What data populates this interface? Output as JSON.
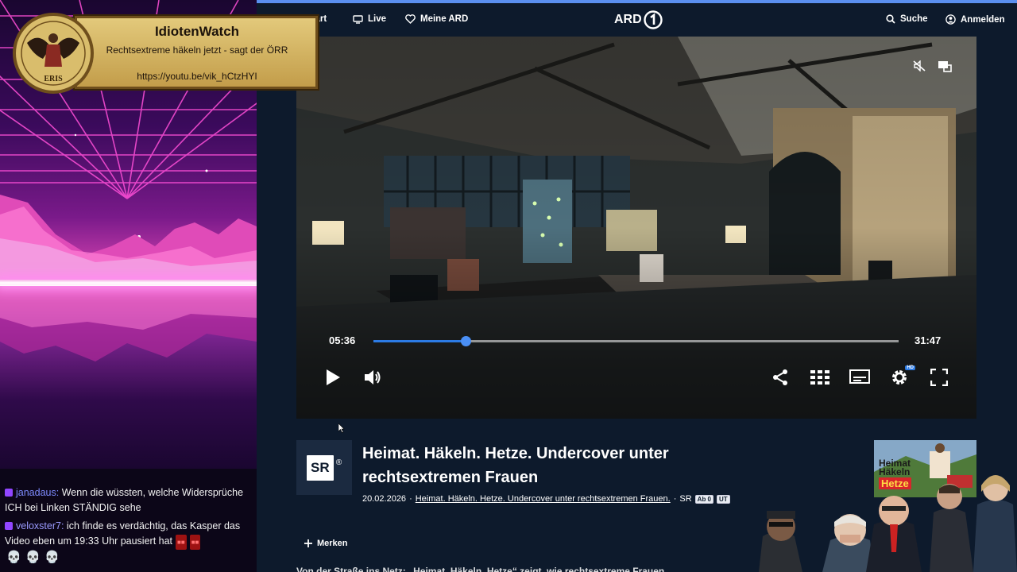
{
  "overlay": {
    "badge": {
      "title": "IdiotenWatch",
      "subtitle": "Rechtsextreme häkeln jetzt - sagt der ÖRR",
      "url": "https://youtu.be/vik_hCtzHYI",
      "seal_text": "ERIS"
    },
    "chat": [
      {
        "user": "janadaus:",
        "text": " Wenn die wüssten, welche Widersprüche ICH bei Linken STÄNDIG sehe",
        "emotes": []
      },
      {
        "user": "veloxster7:",
        "text": " ich finde es verdächtig, das Kasper das Video eben um 19:33 Uhr pausiert hat",
        "emotes": [
          "💀",
          "💀",
          "💀"
        ]
      }
    ]
  },
  "ard": {
    "nav": {
      "start": "Start",
      "live": "Live",
      "meine_ard": "Meine ARD",
      "logo": "ARD",
      "search": "Suche",
      "login": "Anmelden"
    },
    "player": {
      "current_time": "05:36",
      "duration": "31:47",
      "progress_fraction": 0.176,
      "hd_badge": "HD"
    },
    "video": {
      "channel_logo": "SR",
      "title": "Heimat. Häkeln. Hetze. Undercover unter rechtsextremen Frauen",
      "date": "20.02.2026",
      "sep": "·",
      "series_link": "Heimat. Häkeln. Hetze. Undercover unter rechtsextremen Frauen.",
      "broadcaster": "SR",
      "age_badge": "Ab 0",
      "subtitle_badge": "UT",
      "bookmark_label": "Merken",
      "description_peek": "Von der Straße ins Netz: „Heimat. Häkeln. Hetze“ zeigt, wie rechtsextreme Frauen ..."
    },
    "thumbnail": {
      "line1": "Heimat",
      "line2": "Häkeln",
      "line3": "Hetze"
    }
  },
  "colors": {
    "accent": "#2c7be5",
    "page_bg": "#0d1a2c",
    "badge_gold": "#d1b160",
    "chat_user": "#7e8bff"
  }
}
